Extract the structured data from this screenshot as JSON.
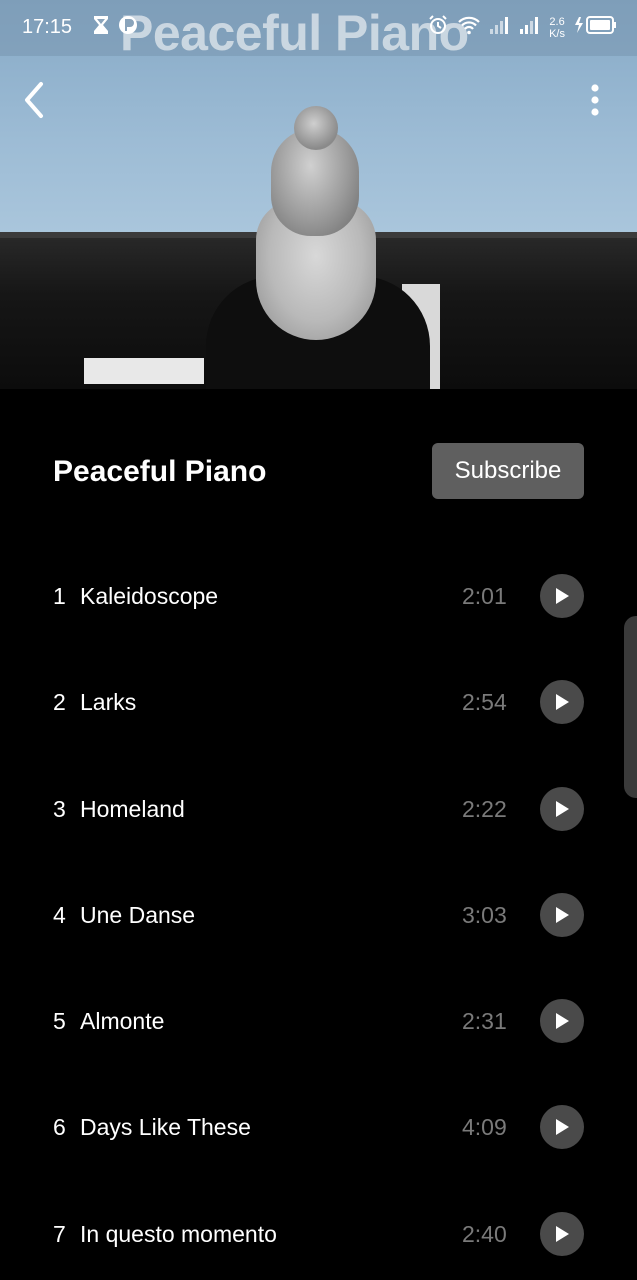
{
  "status_bar": {
    "time": "17:15",
    "speed_value": "2.6",
    "speed_unit": "K/s",
    "overlay_title": "Peaceful Piano"
  },
  "header": {
    "back_icon": "chevron-left-icon",
    "menu_icon": "more-vertical-icon"
  },
  "playlist": {
    "title": "Peaceful Piano",
    "subscribe_label": "Subscribe",
    "tracks": [
      {
        "number": "1",
        "title": "Kaleidoscope",
        "duration": "2:01"
      },
      {
        "number": "2",
        "title": "Larks",
        "duration": "2:54"
      },
      {
        "number": "3",
        "title": "Homeland",
        "duration": "2:22"
      },
      {
        "number": "4",
        "title": "Une Danse",
        "duration": "3:03"
      },
      {
        "number": "5",
        "title": "Almonte",
        "duration": "2:31"
      },
      {
        "number": "6",
        "title": "Days Like These",
        "duration": "4:09"
      },
      {
        "number": "7",
        "title": "In questo momento",
        "duration": "2:40"
      }
    ]
  },
  "colors": {
    "background": "#000000",
    "subscribe_bg": "#5f5f5f",
    "play_button_bg": "#4a4a4a",
    "duration_text": "#7a7a7a"
  }
}
